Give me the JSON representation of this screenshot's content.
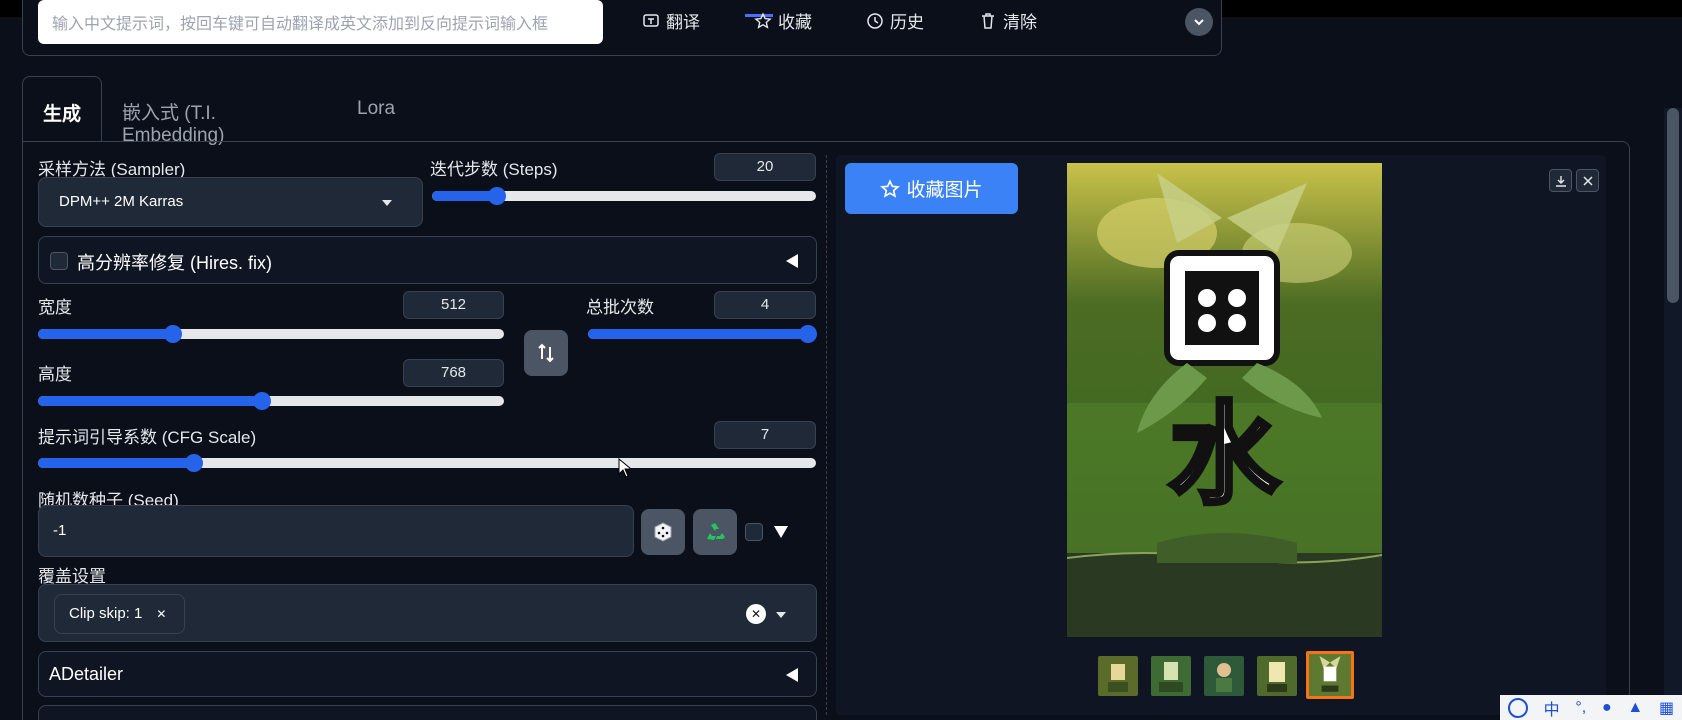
{
  "prompt_bar": {
    "placeholder": "输入中文提示词，按回车键可自动翻译成英文添加到反向提示词输入框",
    "translate_label": "翻译",
    "favorite_label": "收藏",
    "history_label": "历史",
    "clear_label": "清除"
  },
  "tabs": [
    {
      "label": "生成"
    },
    {
      "label": "嵌入式 (T.I. Embedding)"
    },
    {
      "label": "Lora"
    }
  ],
  "sampler": {
    "label": "采样方法 (Sampler)",
    "value": "DPM++ 2M Karras"
  },
  "steps": {
    "label": "迭代步数 (Steps)",
    "value": "20",
    "fraction": 0.17
  },
  "hires": {
    "label": "高分辨率修复 (Hires. fix)"
  },
  "width": {
    "label": "宽度",
    "value": "512",
    "fraction": 0.29
  },
  "height": {
    "label": "高度",
    "value": "768",
    "fraction": 0.48
  },
  "batch_count": {
    "label": "总批次数",
    "value": "4",
    "fraction": 1.0
  },
  "cfg": {
    "label": "提示词引导系数 (CFG Scale)",
    "value": "7",
    "fraction": 0.2
  },
  "seed": {
    "label": "随机数种子 (Seed)",
    "value": "-1"
  },
  "override": {
    "label": "覆盖设置",
    "chip": "Clip skip: 1"
  },
  "adetailer": {
    "label": "ADetailer"
  },
  "gallery": {
    "favorite_image_label": "收藏图片",
    "thumb_count": 5,
    "selected_thumb": 5
  },
  "colors": {
    "accent": "#2563eb",
    "button": "#3b82f6",
    "selected": "#f97316",
    "background": "#0b0f19"
  },
  "ime": {
    "mode": "中"
  }
}
